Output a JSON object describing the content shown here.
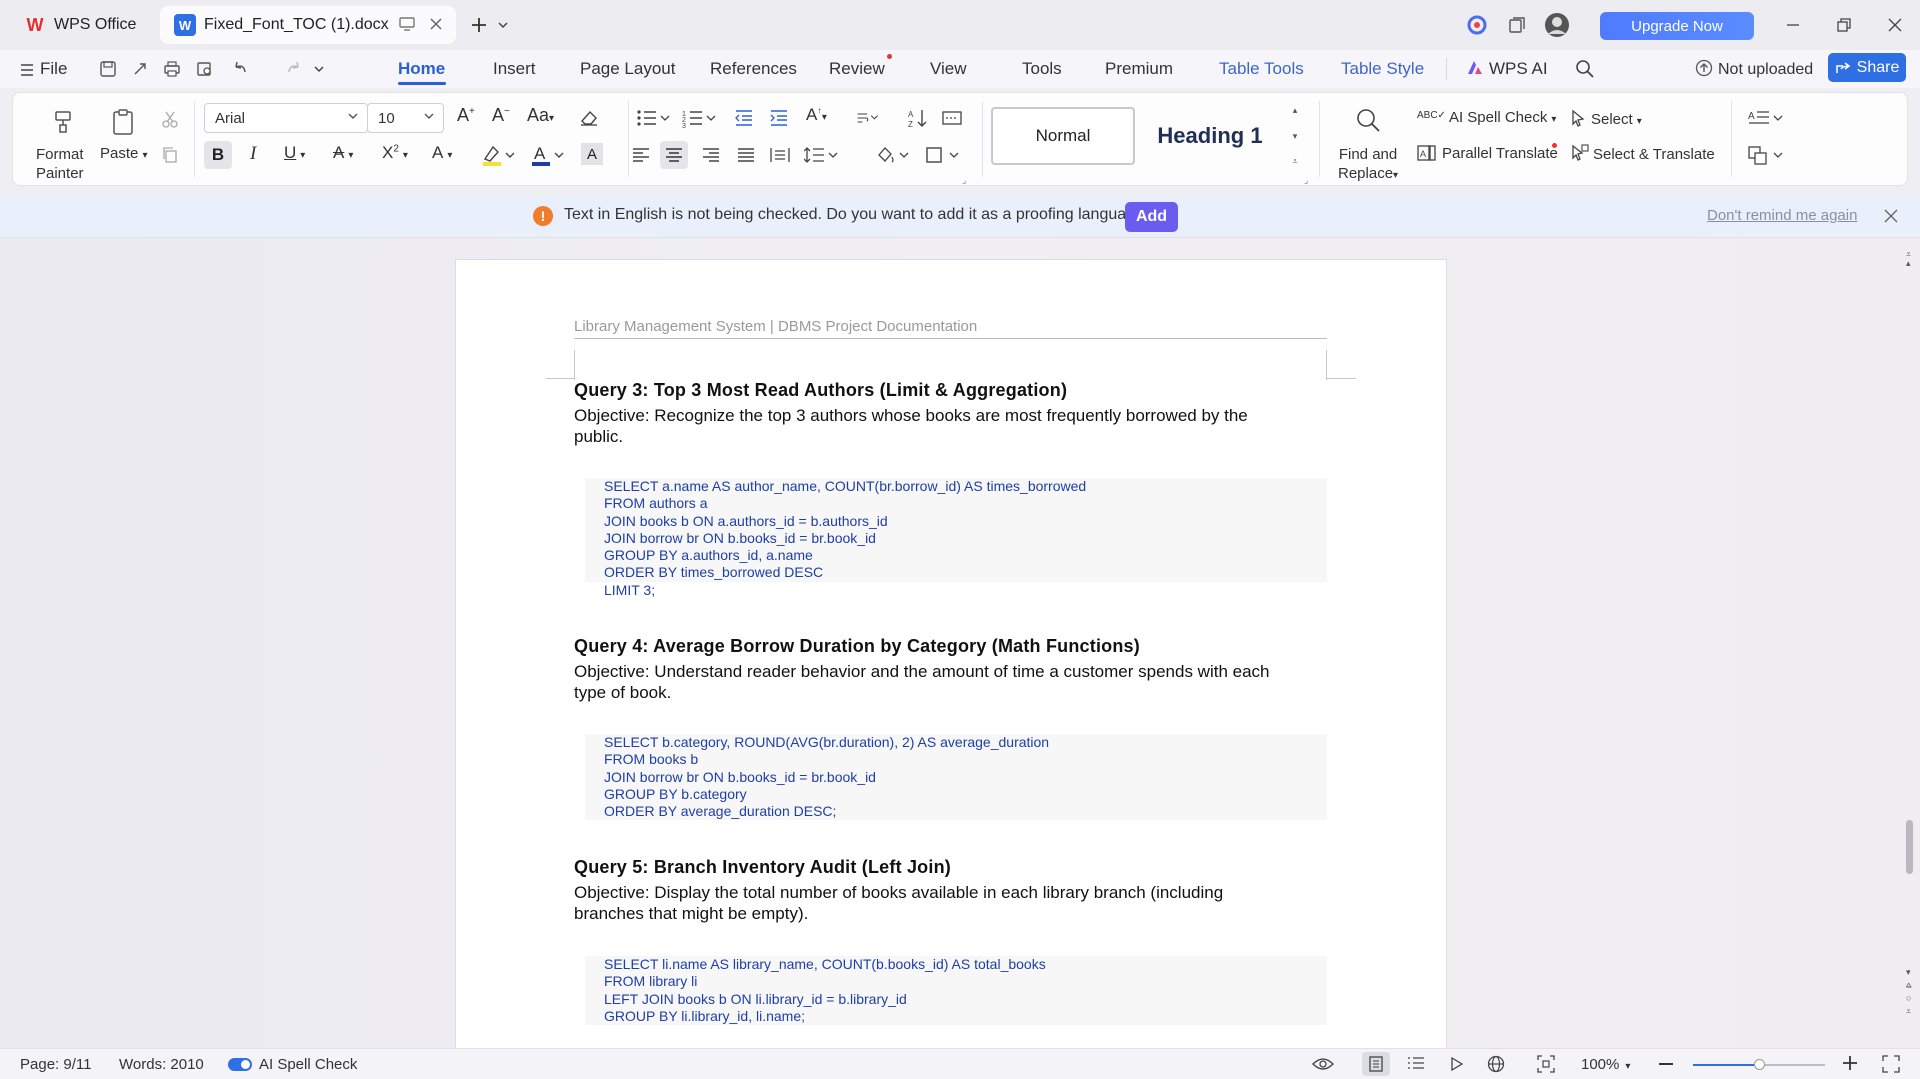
{
  "titlebar": {
    "app_tab": "WPS Office",
    "doc_tab": "Fixed_Font_TOC (1).docx",
    "upgrade": "Upgrade Now"
  },
  "menu": {
    "file": "File",
    "items": [
      "Home",
      "Insert",
      "Page Layout",
      "References",
      "Review",
      "View",
      "Tools",
      "Premium",
      "Table Tools",
      "Table Style"
    ],
    "wps_ai": "WPS AI",
    "not_uploaded": "Not uploaded",
    "share": "Share"
  },
  "ribbon": {
    "format_painter": "Format Painter",
    "format_painter_l1": "Format",
    "format_painter_l2": "Painter",
    "paste": "Paste",
    "font_name": "Arial",
    "font_size": "10",
    "style_normal": "Normal",
    "style_heading1": "Heading 1",
    "find_replace_l1": "Find and",
    "find_replace_l2": "Replace",
    "ai_spell_check": "AI Spell Check",
    "parallel_translate": "Parallel Translate",
    "select": "Select",
    "select_translate": "Select & Translate"
  },
  "notification": {
    "message": "Text in English is not being checked. Do you want to add it as a proofing language?",
    "add": "Add",
    "dont_remind": "Don't remind me again"
  },
  "document": {
    "header": "Library Management System  |  DBMS Project Documentation",
    "queries": [
      {
        "title": "Query 3: Top 3 Most Read Authors (Limit & Aggregation)",
        "objective_l1": "Objective: Recognize the top 3 authors whose books are most frequently borrowed by the",
        "objective_l2": "public.",
        "code": [
          "SELECT a.name AS author_name, COUNT(br.borrow_id) AS times_borrowed",
          "FROM authors a",
          "JOIN books b ON a.authors_id = b.authors_id",
          "JOIN borrow br ON b.books_id = br.book_id",
          "GROUP BY a.authors_id, a.name",
          "ORDER BY times_borrowed DESC",
          "LIMIT 3;"
        ]
      },
      {
        "title": "Query 4: Average Borrow Duration by Category (Math Functions)",
        "objective_l1": "Objective: Understand reader behavior and the amount of time a customer spends with each",
        "objective_l2": "type of book.",
        "code": [
          "SELECT b.category, ROUND(AVG(br.duration), 2) AS average_duration",
          "FROM books b",
          "JOIN borrow br ON b.books_id = br.book_id",
          "GROUP BY b.category",
          "ORDER BY average_duration DESC;"
        ]
      },
      {
        "title": "Query 5: Branch Inventory Audit (Left Join)",
        "objective_l1": "Objective: Display the total number of books available in each library branch (including",
        "objective_l2": "branches that might be empty).",
        "code": [
          "SELECT li.name AS library_name, COUNT(b.books_id) AS total_books",
          "FROM library li",
          "LEFT JOIN books b ON li.library_id = b.library_id",
          "GROUP BY li.library_id, li.name;"
        ]
      }
    ]
  },
  "statusbar": {
    "page": "Page: 9/11",
    "words": "Words: 2010",
    "ai_spell_check": "AI Spell Check",
    "zoom": "100%"
  },
  "colors": {
    "accent": "#2a5fd8",
    "code_text": "#1e3ea8",
    "add_button": "#6b5cf0",
    "notify_bg": "#eaf0fb"
  }
}
